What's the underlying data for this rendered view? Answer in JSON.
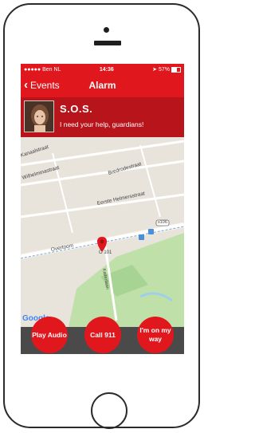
{
  "status_bar": {
    "carrier": "●●●●● Ben NL",
    "time": "14:36",
    "battery_pct": "57%"
  },
  "nav": {
    "back_label": "Events",
    "title": "Alarm"
  },
  "alert": {
    "title": "S.O.S.",
    "message": "I need your help, guardians!"
  },
  "map": {
    "streets": [
      "Kanaalstraat",
      "Wilhelminastraat",
      "Bredrodestraat",
      "Eerste Helmersstraat",
      "Overtoom",
      "Kattenlaan"
    ],
    "road_number": "s106",
    "pin_label": "O  101",
    "attribution": "Google"
  },
  "actions": [
    {
      "label": "Play Audio"
    },
    {
      "label": "Call 911"
    },
    {
      "label": "I'm on my way"
    }
  ],
  "colors": {
    "accent": "#e1171e",
    "banner": "#b8141b",
    "actionbar": "#4a4a4a"
  }
}
